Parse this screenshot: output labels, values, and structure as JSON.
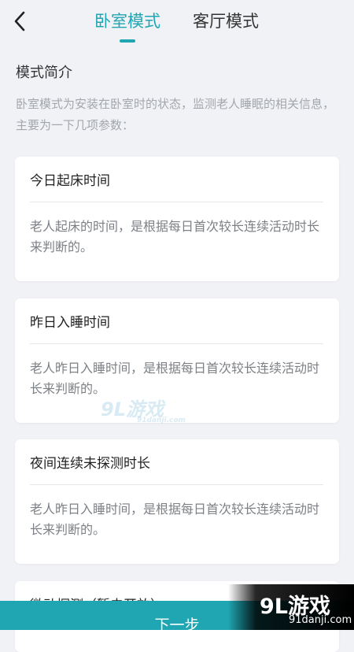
{
  "header": {
    "back_icon": "chevron-left-icon",
    "tabs": [
      {
        "label": "卧室模式",
        "active": true
      },
      {
        "label": "客厅模式",
        "active": false
      }
    ],
    "accent_color": "#1fa6b2"
  },
  "intro": {
    "title": "模式简介",
    "description": "卧室模式为安装在卧室时的状态，监测老人睡眠的相关信息，主要为一下几项参数："
  },
  "cards": [
    {
      "title": "今日起床时间",
      "description": "老人起床的时间，是根据每日首次较长连续活动时长来判断的。"
    },
    {
      "title": "昨日入睡时间",
      "description": "老人昨日入睡时间，是根据每日首次较长连续活动时长来判断的。"
    },
    {
      "title": "夜间连续未探测时长",
      "description": "老人昨日入睡时间，是根据每日首次较长连续活动时长来判断的。"
    },
    {
      "title": "微动探测（暂未开放）",
      "description": ""
    }
  ],
  "footer": {
    "next_label": "下一步"
  },
  "watermarks": {
    "center_logo": "9L游戏",
    "center_site": "91danji.com",
    "corner_logo": "9L游戏",
    "corner_site": "91danji.com"
  }
}
